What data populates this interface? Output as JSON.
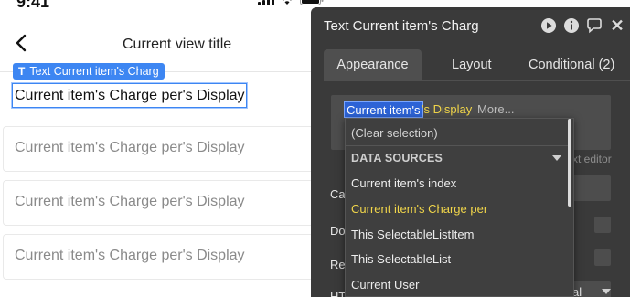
{
  "status_bar": {
    "time": "9:41"
  },
  "nav": {
    "title": "Current view title"
  },
  "canvas": {
    "element_tag": "Text Current item's Charg",
    "selected_text": "Current item's Charge per's Display",
    "list_cells": [
      "Current item's Charge per's Display",
      "Current item's Charge per's Display",
      "Current item's Charge per's Display"
    ]
  },
  "panel": {
    "title": "Text Current item's Charg",
    "tabs": [
      "Appearance",
      "Layout",
      "Conditional (2)"
    ],
    "dynamic_expression": {
      "selected": "Current item's",
      "rest": "'s Display",
      "more": "More..."
    },
    "hidden_labels": [
      "Ca",
      "Do",
      "Re",
      "HT"
    ],
    "ghost_right": "xt editor",
    "ghost_bottom": "al"
  },
  "dropdown": {
    "clear_label": "(Clear selection)",
    "section_label": "DATA SOURCES",
    "items": [
      "Current item's index",
      "Current item's Charge per",
      "This SelectableListItem",
      "This SelectableList",
      "Current User"
    ],
    "highlight_index": 1
  },
  "colors": {
    "accent": "#3d86f2",
    "panel_bg": "#3a3a3a",
    "highlight_text": "#f0d54a"
  }
}
